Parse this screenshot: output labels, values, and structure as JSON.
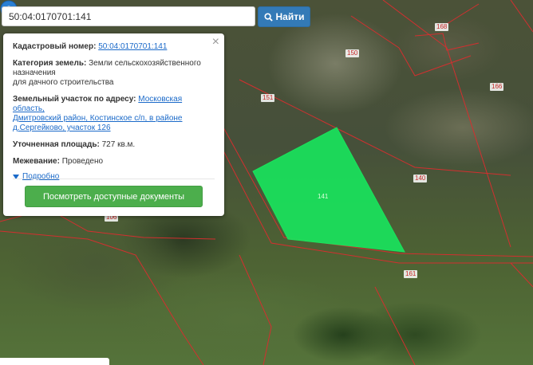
{
  "search": {
    "value": "50:04:0170701:141",
    "button_label": "Найти"
  },
  "popup": {
    "cadastral_label": "Кадастровый номер:",
    "cadastral_value": "50:04:0170701:141",
    "category_label": "Категория земель:",
    "category_value_1": "Земли сельскохозяйственного",
    "category_value_2": "назначения",
    "category_value_3": "для дачного строительства",
    "address_label": "Земельный участок по адресу:",
    "address_line_1": "Московская область,",
    "address_line_2": "Дмитровский район, Костинское с/п, в районе",
    "address_line_3": "д.Сергейково, участок 126",
    "area_label": "Уточненная площадь:",
    "area_value": "727 кв.м.",
    "survey_label": "Межевание:",
    "survey_value": "Проведено",
    "more_label": "Подробно",
    "docs_button": "Посмотреть доступные документы",
    "close_symbol": "×"
  },
  "map": {
    "labels": {
      "l168": "168",
      "l150": "150",
      "l166": "166",
      "l151": "151",
      "l140": "140",
      "l141": "141",
      "l106": "106",
      "l161": "161"
    },
    "colors": {
      "parcel_fill": "#19e35c",
      "boundary": "#d32f2f",
      "pin": "#2a7fd4"
    }
  }
}
